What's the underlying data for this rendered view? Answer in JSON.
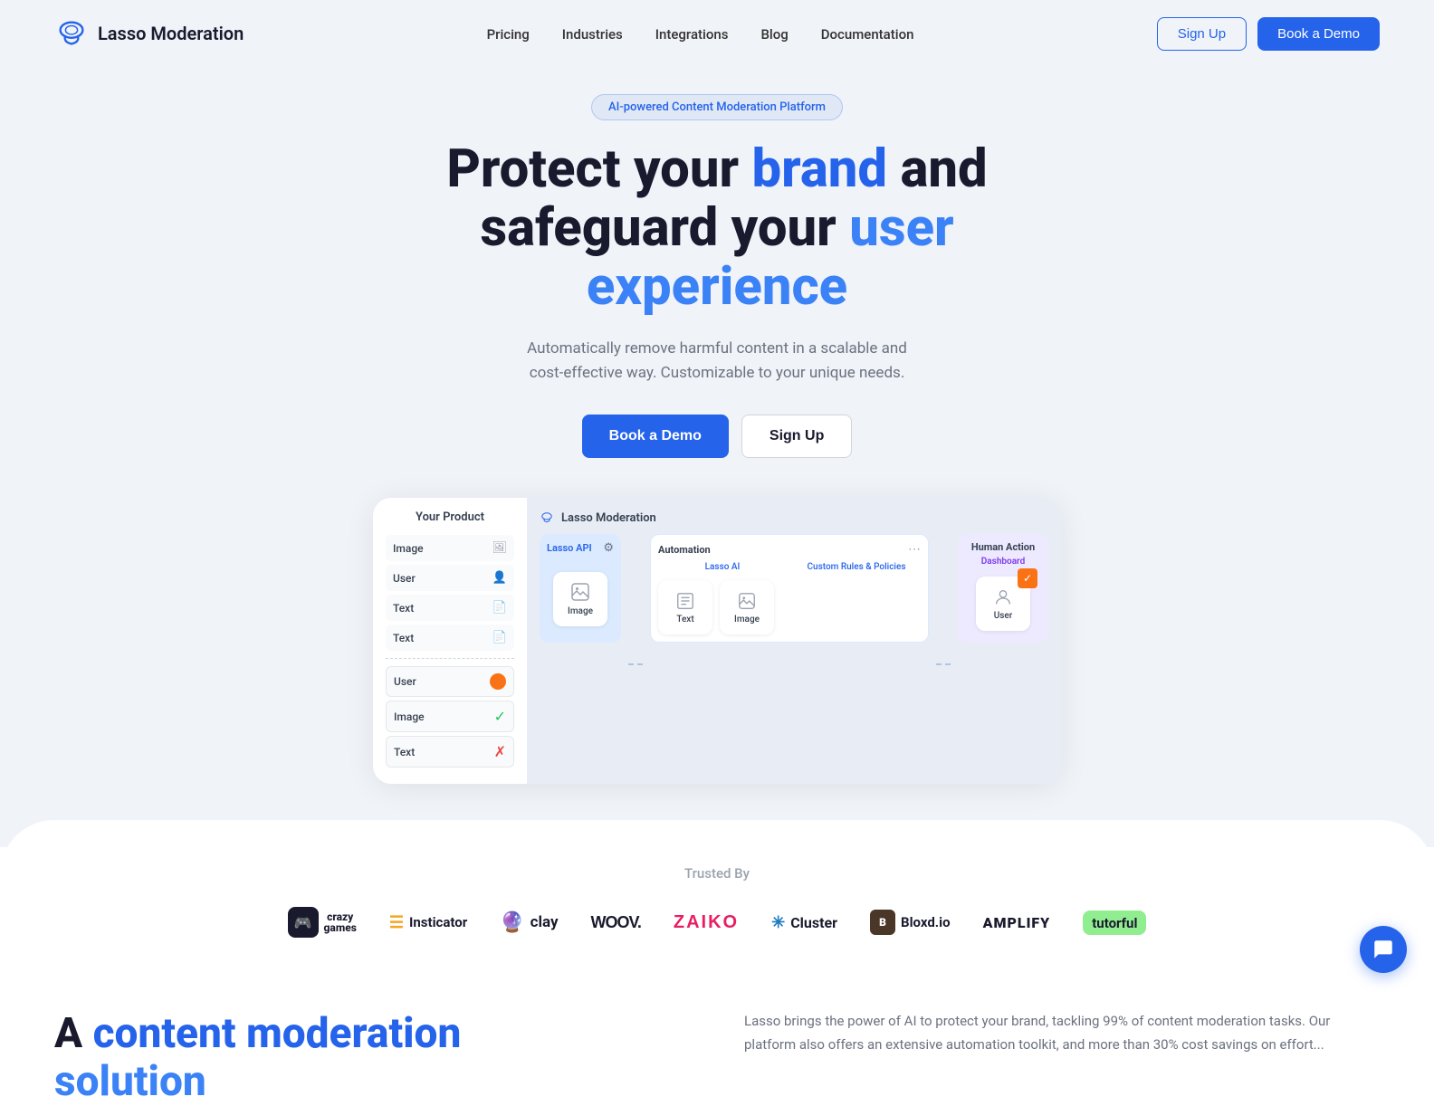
{
  "nav": {
    "logo_text": "Lasso Moderation",
    "links": [
      {
        "label": "Pricing",
        "id": "pricing"
      },
      {
        "label": "Industries",
        "id": "industries"
      },
      {
        "label": "Integrations",
        "id": "integrations"
      },
      {
        "label": "Blog",
        "id": "blog"
      },
      {
        "label": "Documentation",
        "id": "documentation"
      }
    ],
    "signup_label": "Sign Up",
    "demo_label": "Book a Demo"
  },
  "hero": {
    "badge": "AI-powered Content Moderation Platform",
    "title_line1": "Protect your ",
    "title_highlight1": "brand",
    "title_line2": " and",
    "title_line3": "safeguard your ",
    "title_highlight2": "user experience",
    "subtitle": "Automatically remove harmful content in a scalable and cost-effective way. Customizable to your unique needs.",
    "btn_demo": "Book a Demo",
    "btn_signup": "Sign Up"
  },
  "diagram": {
    "your_product_label": "Your Product",
    "lasso_label": "Lasso Moderation",
    "api_label": "Lasso API",
    "automation_label": "Automation",
    "lasso_ai_label": "Lasso AI",
    "custom_rules_label": "Custom Rules & Policies",
    "human_action_label": "Human Action",
    "dashboard_label": "Dashboard",
    "items": {
      "image": "Image",
      "user": "User",
      "text": "Text"
    },
    "product_rows": [
      {
        "label": "Image",
        "icon": "🖼"
      },
      {
        "label": "User",
        "icon": "👤"
      },
      {
        "label": "Text",
        "icon": "📄"
      },
      {
        "label": "Text",
        "icon": "📄"
      }
    ],
    "result_rows": [
      {
        "label": "User",
        "status": "orange"
      },
      {
        "label": "Image",
        "status": "green"
      },
      {
        "label": "Text",
        "status": "red"
      }
    ]
  },
  "trusted": {
    "title": "Trusted By",
    "logos": [
      {
        "name": "CrazyGames",
        "id": "crazygames"
      },
      {
        "name": "Insticator",
        "id": "insticator"
      },
      {
        "name": "clay",
        "id": "clay"
      },
      {
        "name": "WOOV.",
        "id": "woov"
      },
      {
        "name": "ZAIKO",
        "id": "zaiko"
      },
      {
        "name": "Cluster",
        "id": "cluster"
      },
      {
        "name": "Bloxd.io",
        "id": "bloxd"
      },
      {
        "name": "AMPLIFY",
        "id": "amplify"
      },
      {
        "name": "tutorful",
        "id": "tutorful"
      }
    ]
  },
  "content_section": {
    "title_pre": "A ",
    "title_highlight1": "content moderation",
    "title_post": " solution",
    "description": "Lasso brings the power of AI to protect your brand, tackling 99% of content moderation tasks. Our platform also offers an extensive automation toolkit, and more than 30% cost savings on effort..."
  }
}
